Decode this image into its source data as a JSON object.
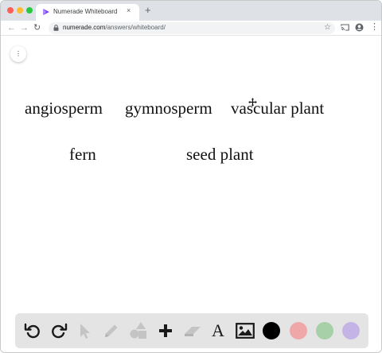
{
  "browser": {
    "tab_title": "Numerade Whiteboard",
    "tab_close": "×",
    "new_tab": "+",
    "url_host": "numerade.com",
    "url_path": "/answers/whiteboard/",
    "icons": {
      "back": "arrow-left-icon",
      "forward": "arrow-right-icon",
      "reload": "reload-icon",
      "lock": "lock-icon",
      "star": "star-icon",
      "cast": "cast-icon",
      "account": "account-icon",
      "menu": "kebab-menu-icon"
    },
    "glyphs": {
      "back": "←",
      "forward": "→",
      "reload": "↻",
      "star": "☆",
      "menu": "⋮"
    }
  },
  "canvas": {
    "menu_glyph": "⋮",
    "words": {
      "angiosperm": "angiosperm",
      "gymnosperm": "gymnosperm",
      "vascular_plant": "vascular plant",
      "fern": "fern",
      "seed_plant": "seed plant"
    }
  },
  "drawbar": {
    "tools": [
      "undo-icon",
      "redo-icon",
      "select-arrow-icon",
      "pen-icon",
      "shapes-icon",
      "plus-icon",
      "eraser-icon",
      "text-icon",
      "image-icon"
    ],
    "text_glyph": "A",
    "colors": [
      "#000000",
      "#f0a7a7",
      "#a8d0a8",
      "#c4b4e6"
    ],
    "selected_color": "#000000"
  }
}
